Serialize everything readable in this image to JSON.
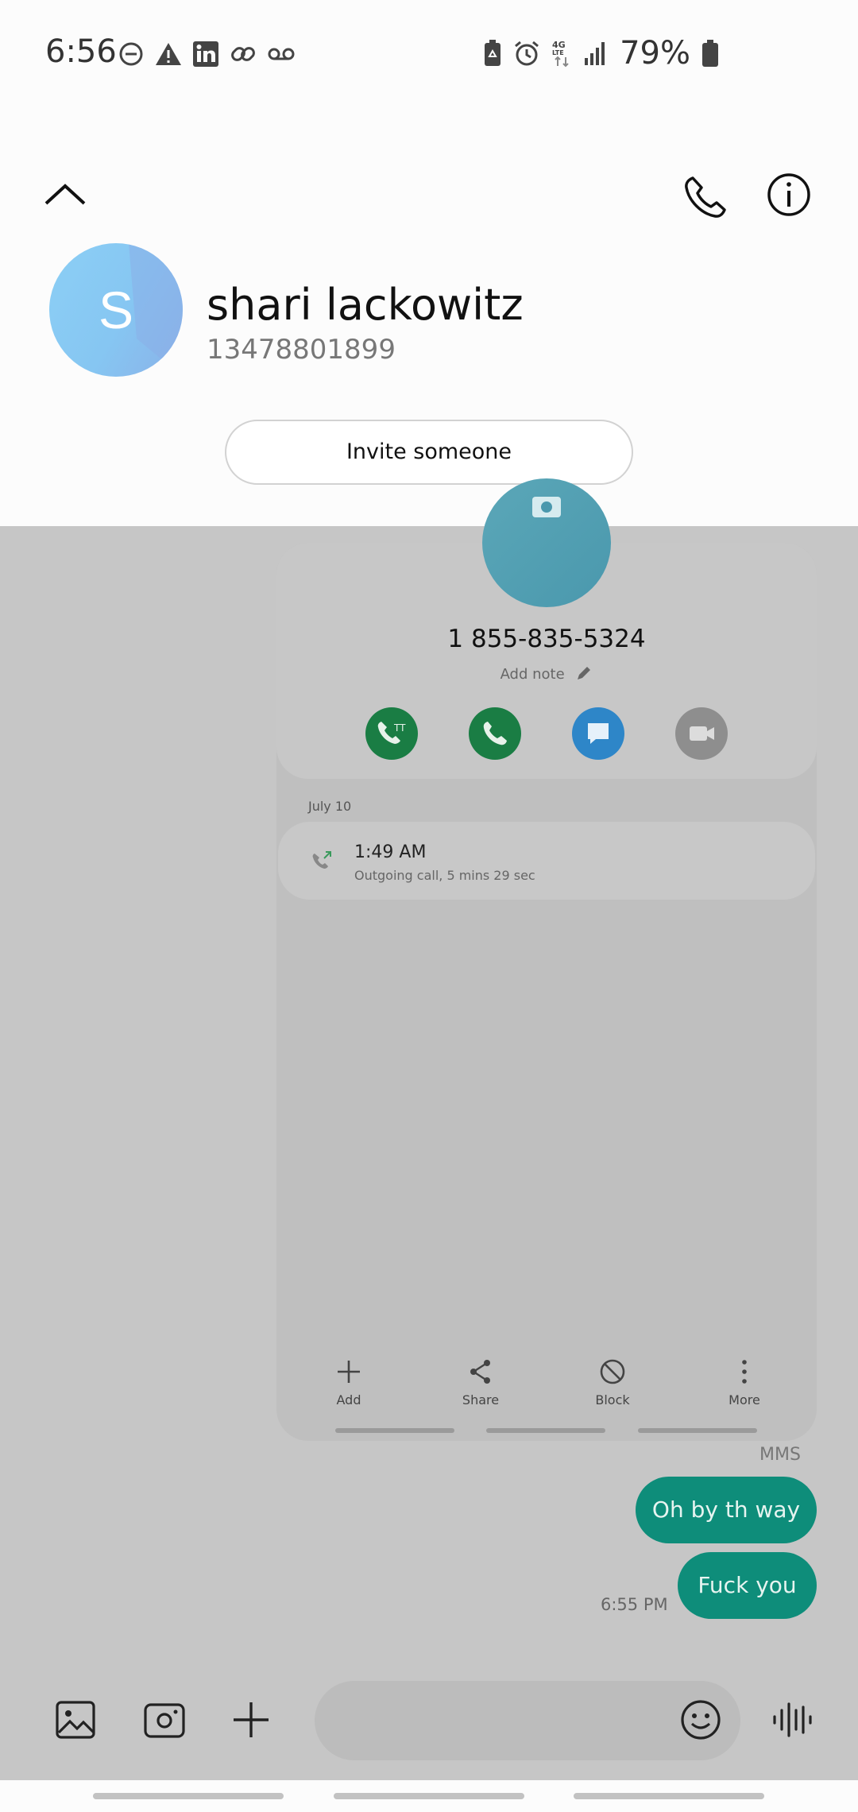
{
  "status_bar": {
    "time": "6:56",
    "battery_percent": "79%",
    "left_icons": [
      "do-not-disturb-icon",
      "alert-icon",
      "linkedin-icon",
      "link-icon",
      "voicemail-icon"
    ],
    "right_icons": [
      "battery-saver-icon",
      "alarm-icon",
      "4g-lte-icon",
      "signal-icon",
      "battery-icon"
    ]
  },
  "header": {
    "avatar_letter": "S",
    "contact_name": "shari lackowitz",
    "contact_number": "13478801899",
    "invite_label": "Invite someone"
  },
  "contact_card": {
    "phone_number": "1 855-835-5324",
    "add_note_label": "Add note",
    "actions": [
      "rtt-call",
      "voice-call",
      "message",
      "video-call"
    ],
    "history_date": "July 10",
    "call_entry": {
      "time": "1:49 AM",
      "description": "Outgoing call, 5 mins 29 sec"
    },
    "bottom_actions": [
      {
        "label": "Add",
        "icon": "plus-icon"
      },
      {
        "label": "Share",
        "icon": "share-icon"
      },
      {
        "label": "Block",
        "icon": "block-icon"
      },
      {
        "label": "More",
        "icon": "more-icon"
      }
    ]
  },
  "messages": {
    "type_label": "MMS",
    "items": [
      {
        "text": "Oh by th way"
      },
      {
        "text": "Fuck you"
      }
    ],
    "timestamp": "6:55 PM"
  },
  "composer": {
    "input_placeholder": ""
  },
  "colors": {
    "bubble": "#0e8d7a",
    "avatar": "#8ccff5",
    "overlay": "#c6c6c6"
  }
}
